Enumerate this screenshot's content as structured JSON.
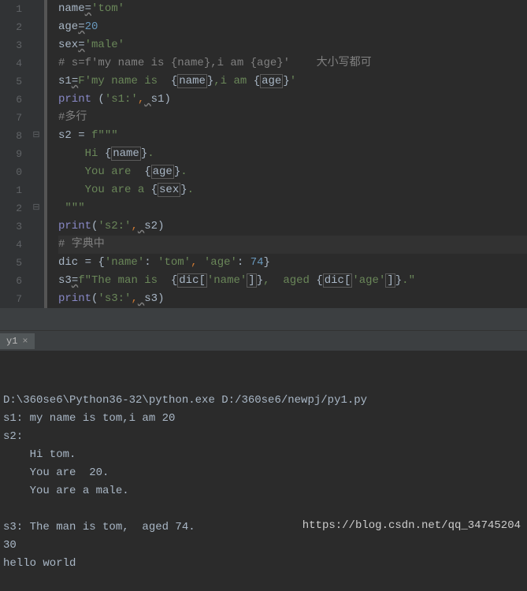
{
  "editor": {
    "lines": [
      {
        "n": "1",
        "f": "",
        "tokens": [
          [
            "var",
            "name"
          ],
          [
            "warn",
            "="
          ],
          [
            "str",
            "'tom'"
          ]
        ]
      },
      {
        "n": "2",
        "f": "",
        "tokens": [
          [
            "var",
            "age"
          ],
          [
            "warn",
            "="
          ],
          [
            "num",
            "20"
          ]
        ]
      },
      {
        "n": "3",
        "f": "",
        "tokens": [
          [
            "var",
            "sex"
          ],
          [
            "warn",
            "="
          ],
          [
            "str",
            "'male'"
          ]
        ]
      },
      {
        "n": "4",
        "f": "",
        "tokens": [
          [
            "com",
            "# s=f'my name is {name},i am {age}'    大小写都可"
          ]
        ]
      },
      {
        "n": "5",
        "f": "",
        "tokens": [
          [
            "var",
            "s1"
          ],
          [
            "warn",
            "="
          ],
          [
            "str",
            "F'"
          ],
          [
            "str",
            "my name is "
          ],
          [
            "var",
            " {"
          ],
          [
            "box",
            "name"
          ],
          [
            "var",
            "}"
          ],
          [
            "str",
            ",i am "
          ],
          [
            "var",
            "{"
          ],
          [
            "box",
            "age"
          ],
          [
            "var",
            "}"
          ],
          [
            "str",
            "'"
          ]
        ]
      },
      {
        "n": "6",
        "f": "",
        "tokens": [
          [
            "fn",
            "print"
          ],
          [
            "plain",
            " ("
          ],
          [
            "str",
            "'s1:'"
          ],
          [
            "kw",
            ","
          ],
          [
            "warn",
            " "
          ],
          [
            "var",
            "s1"
          ],
          [
            "plain",
            ")"
          ]
        ]
      },
      {
        "n": "7",
        "f": "",
        "tokens": [
          [
            "com",
            "#多行"
          ]
        ]
      },
      {
        "n": "8",
        "f": "⊟",
        "tokens": [
          [
            "var",
            "s2 = "
          ],
          [
            "str",
            "f\"\"\""
          ]
        ]
      },
      {
        "n": "9",
        "f": "",
        "tokens": [
          [
            "str",
            "    Hi "
          ],
          [
            "var",
            "{"
          ],
          [
            "box",
            "name"
          ],
          [
            "var",
            "}"
          ],
          [
            "str",
            "."
          ]
        ]
      },
      {
        "n": "0",
        "f": "",
        "tokens": [
          [
            "str",
            "    You are  "
          ],
          [
            "var",
            "{"
          ],
          [
            "box",
            "age"
          ],
          [
            "var",
            "}"
          ],
          [
            "str",
            "."
          ]
        ]
      },
      {
        "n": "1",
        "f": "",
        "tokens": [
          [
            "str",
            "    You are a "
          ],
          [
            "var",
            "{"
          ],
          [
            "box",
            "sex"
          ],
          [
            "var",
            "}"
          ],
          [
            "str",
            "."
          ]
        ]
      },
      {
        "n": "2",
        "f": "⊟",
        "tokens": [
          [
            "str",
            " \"\"\""
          ]
        ]
      },
      {
        "n": "3",
        "f": "",
        "tokens": [
          [
            "fn",
            "print"
          ],
          [
            "plain",
            "("
          ],
          [
            "str",
            "'s2:'"
          ],
          [
            "kw",
            ","
          ],
          [
            "warn",
            " "
          ],
          [
            "var",
            "s2"
          ],
          [
            "plain",
            ")"
          ]
        ]
      },
      {
        "n": "4",
        "f": "",
        "hl": true,
        "tokens": [
          [
            "com",
            "# 字典中"
          ]
        ]
      },
      {
        "n": "5",
        "f": "",
        "tokens": [
          [
            "var",
            "dic = "
          ],
          [
            "plain",
            "{"
          ],
          [
            "str",
            "'name'"
          ],
          [
            "plain",
            ": "
          ],
          [
            "str",
            "'tom'"
          ],
          [
            "kw",
            ","
          ],
          [
            "plain",
            " "
          ],
          [
            "str",
            "'age'"
          ],
          [
            "plain",
            ": "
          ],
          [
            "num",
            "74"
          ],
          [
            "plain",
            "}"
          ]
        ]
      },
      {
        "n": "6",
        "f": "",
        "tokens": [
          [
            "var",
            "s3"
          ],
          [
            "warn",
            "="
          ],
          [
            "str",
            "f\""
          ],
          [
            "str",
            "The man is "
          ],
          [
            "var",
            " {"
          ],
          [
            "box",
            "dic["
          ],
          [
            "str",
            "'name'"
          ],
          [
            "box",
            "]"
          ],
          [
            "var",
            "}"
          ],
          [
            "str",
            ",  aged "
          ],
          [
            "var",
            "{"
          ],
          [
            "box",
            "dic["
          ],
          [
            "str",
            "'age'"
          ],
          [
            "box",
            "]"
          ],
          [
            "var",
            "}"
          ],
          [
            "str",
            ".\""
          ]
        ]
      },
      {
        "n": "7",
        "f": "",
        "tokens": [
          [
            "fn",
            "print"
          ],
          [
            "plain",
            "("
          ],
          [
            "str",
            "'s3:'"
          ],
          [
            "kw",
            ","
          ],
          [
            "warn",
            " "
          ],
          [
            "var",
            "s3"
          ],
          [
            "plain",
            ")"
          ]
        ]
      }
    ]
  },
  "tab": {
    "label": "y1",
    "close": "×"
  },
  "console": {
    "lines": [
      "D:\\360se6\\Python36-32\\python.exe D:/360se6/newpj/py1.py",
      "s1: my name is tom,i am 20",
      "s2: ",
      "    Hi tom.",
      "    You are  20.",
      "    You are a male.",
      "    ",
      "s3: The man is tom,  aged 74.",
      "30",
      "hello world"
    ]
  },
  "watermark": "https://blog.csdn.net/qq_34745204"
}
